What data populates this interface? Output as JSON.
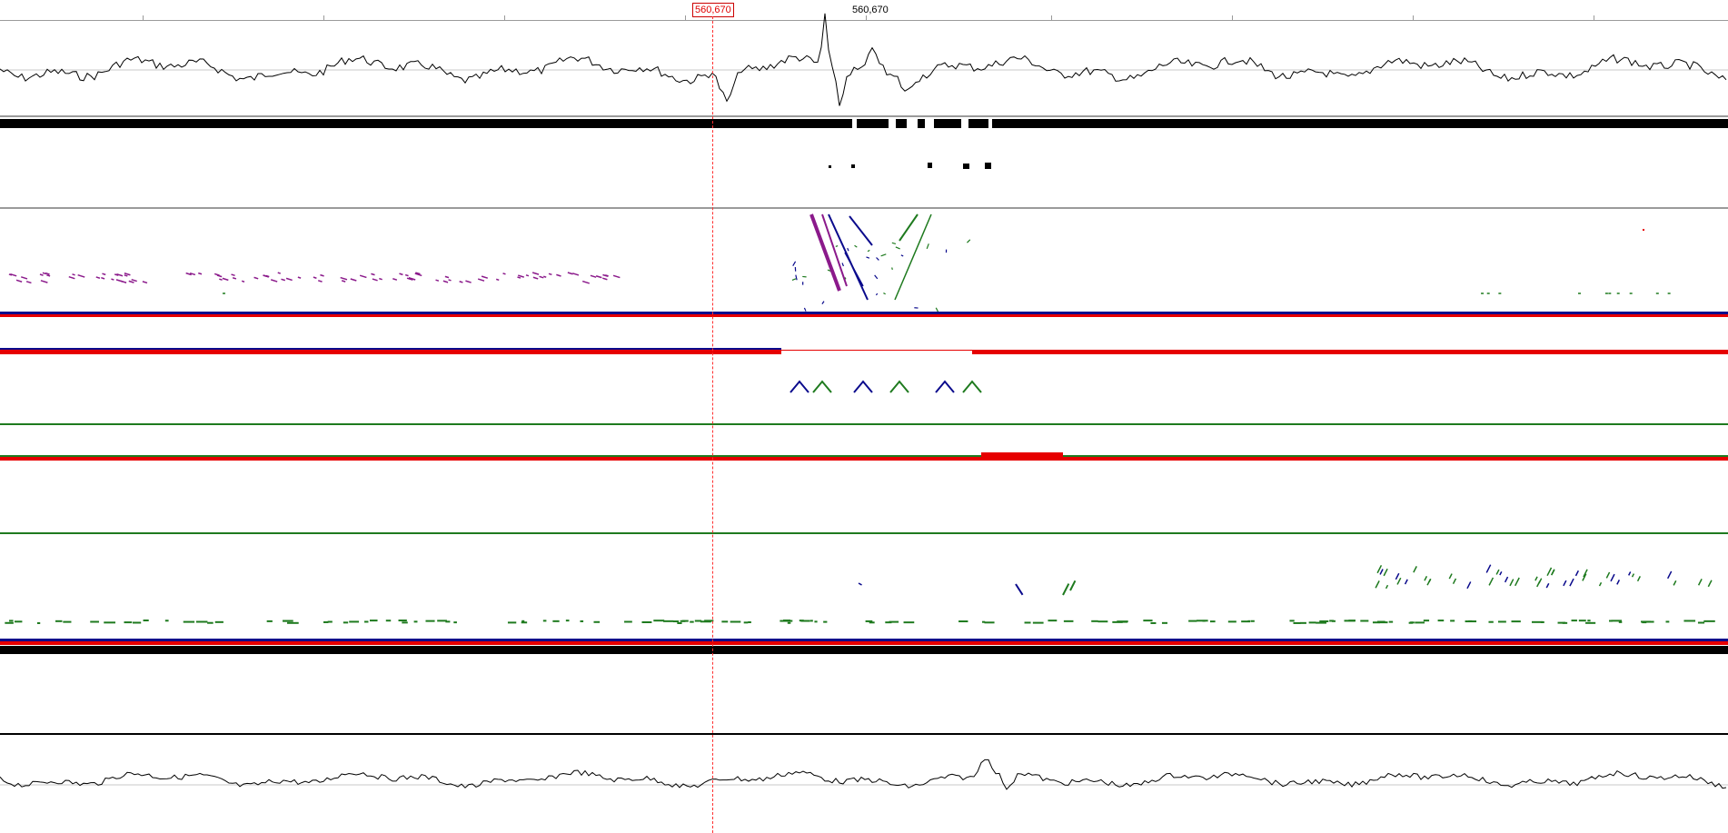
{
  "ruler": {
    "cursor_label": "560,670",
    "position_label": "560,670"
  },
  "colors": {
    "forward_read": "#0a0a8c",
    "reverse_read": "#e60000",
    "match": "#1e7a1e",
    "inversion": "#8b1a8b",
    "graph_line": "#000000",
    "cursor": "#ff3030"
  },
  "tracks": [
    {
      "name": "gc-content-graph-top"
    },
    {
      "name": "coverage-track"
    },
    {
      "name": "comparison-track-1"
    },
    {
      "name": "comparison-track-2"
    },
    {
      "name": "comparison-track-3"
    },
    {
      "name": "gc-content-graph-bottom"
    }
  ]
}
